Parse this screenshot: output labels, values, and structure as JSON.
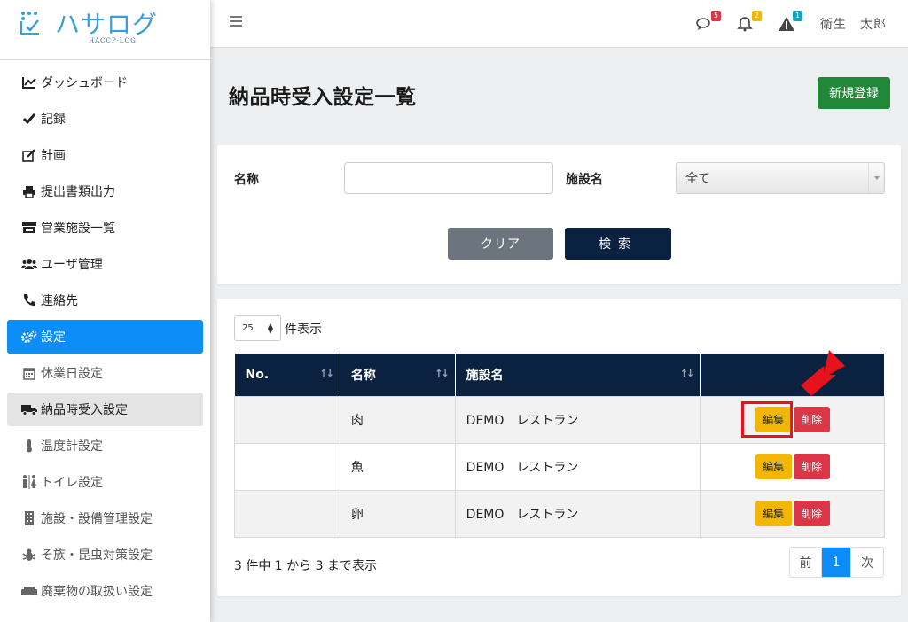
{
  "brand": {
    "name": "ハサログ",
    "sub": "HACCP·LOG"
  },
  "sidebar": {
    "items": [
      {
        "label": "ダッシュボード",
        "icon": "chart-line-icon"
      },
      {
        "label": "記録",
        "icon": "check-icon"
      },
      {
        "label": "計画",
        "icon": "edit-icon"
      },
      {
        "label": "提出書類出力",
        "icon": "print-icon"
      },
      {
        "label": "営業施設一覧",
        "icon": "store-icon"
      },
      {
        "label": "ユーザ管理",
        "icon": "users-icon"
      },
      {
        "label": "連絡先",
        "icon": "phone-icon"
      },
      {
        "label": "設定",
        "icon": "gears-icon"
      },
      {
        "label": "休業日設定",
        "icon": "calendar-icon"
      },
      {
        "label": "納品時受入設定",
        "icon": "truck-icon"
      },
      {
        "label": "温度計設定",
        "icon": "thermometer-icon"
      },
      {
        "label": "トイレ設定",
        "icon": "restroom-icon"
      },
      {
        "label": "施設・設備管理設定",
        "icon": "building-icon"
      },
      {
        "label": "そ族・昆虫対策設定",
        "icon": "bug-icon"
      },
      {
        "label": "廃棄物の取扱い設定",
        "icon": "couch-icon"
      }
    ]
  },
  "topbar": {
    "messages_count": "5",
    "notifications_count": "2",
    "alerts_count": "1",
    "user_name": "衛生　太郎",
    "colors": {
      "messages": "#dc3545",
      "notifications": "#f2b705",
      "alerts": "#17a2b8"
    }
  },
  "page": {
    "title": "納品時受入設定一覧",
    "new_button": "新規登録"
  },
  "search": {
    "name_label": "名称",
    "name_value": "",
    "facility_label": "施設名",
    "facility_selected": "全て",
    "clear_button": "クリア",
    "search_button": "検索"
  },
  "list": {
    "per_page": "25",
    "per_page_suffix": "件表示",
    "columns": [
      "No.",
      "名称",
      "施設名",
      ""
    ],
    "rows": [
      {
        "no": "",
        "name": "肉",
        "facility": "DEMO　レストラン",
        "edit": "編集",
        "delete": "削除"
      },
      {
        "no": "",
        "name": "魚",
        "facility": "DEMO　レストラン",
        "edit": "編集",
        "delete": "削除"
      },
      {
        "no": "",
        "name": "卵",
        "facility": "DEMO　レストラン",
        "edit": "編集",
        "delete": "削除"
      }
    ],
    "info": "3 件中 1 から 3 まで表示",
    "pager": {
      "prev": "前",
      "current": "1",
      "next": "次"
    }
  }
}
